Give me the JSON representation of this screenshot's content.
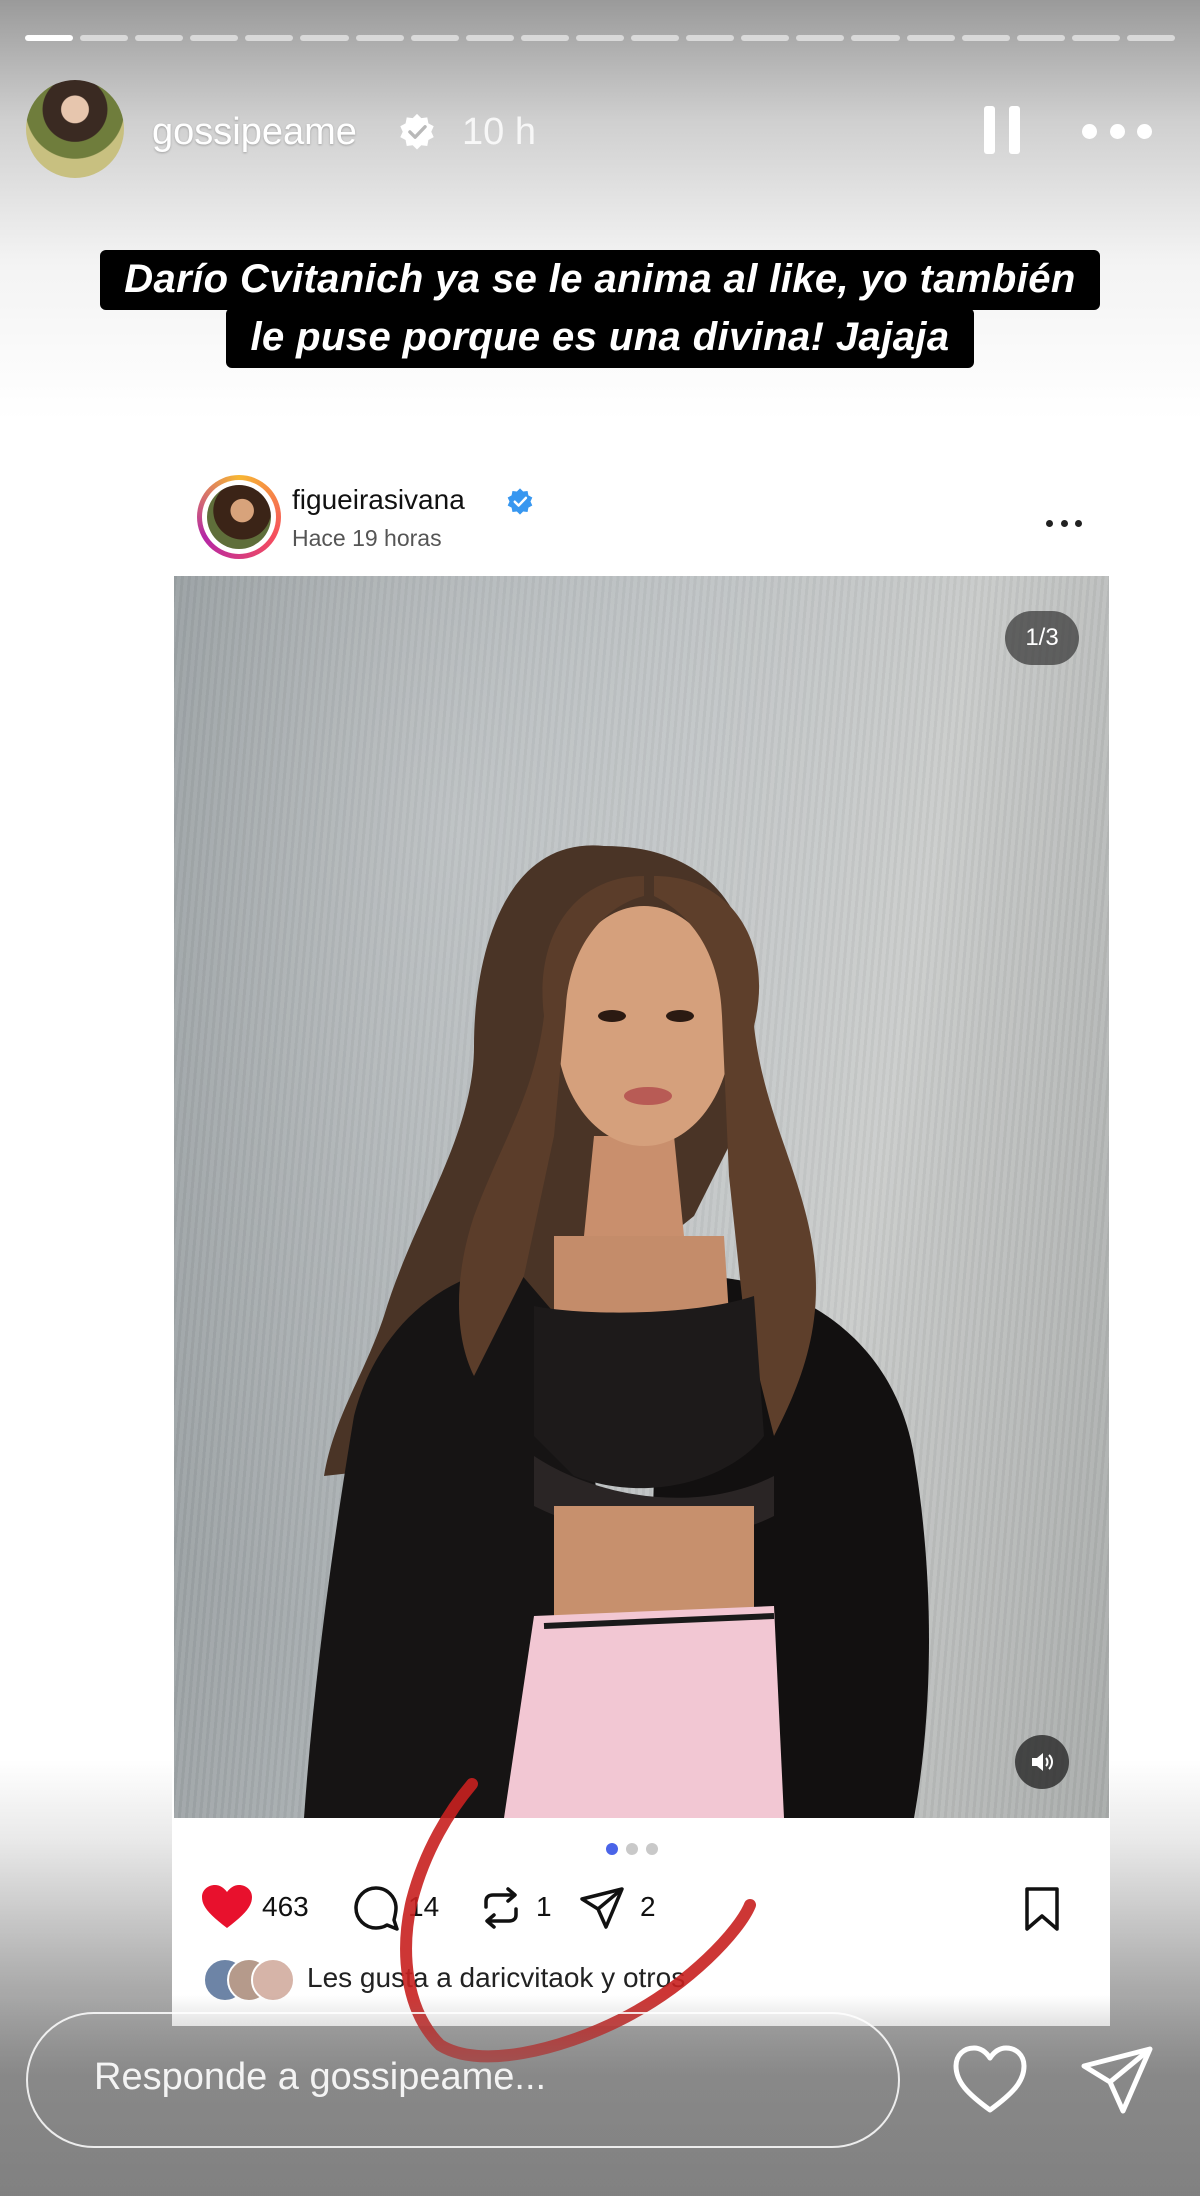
{
  "story": {
    "username": "gossipeame",
    "time": "10 h",
    "progress": {
      "segments": 21,
      "active_segment": 1
    },
    "caption_lines": [
      "Darío Cvitanich ya se le anima al like, yo también",
      "le puse porque es una divina! Jajaja"
    ]
  },
  "post": {
    "username": "figueirasivana",
    "time": "Hace 19 horas",
    "image_counter": "1/3",
    "carousel": {
      "count": 3,
      "active": 1
    },
    "likes": "463",
    "comments": "14",
    "reposts": "1",
    "shares": "2",
    "likes_text": "Les gusta a daricvitaok y otros"
  },
  "reply": {
    "placeholder": "Responde a gossipeame..."
  },
  "colors": {
    "like_red": "#e8112d",
    "verified_blue": "#3897f0",
    "annotation_red": "#c8201f"
  }
}
